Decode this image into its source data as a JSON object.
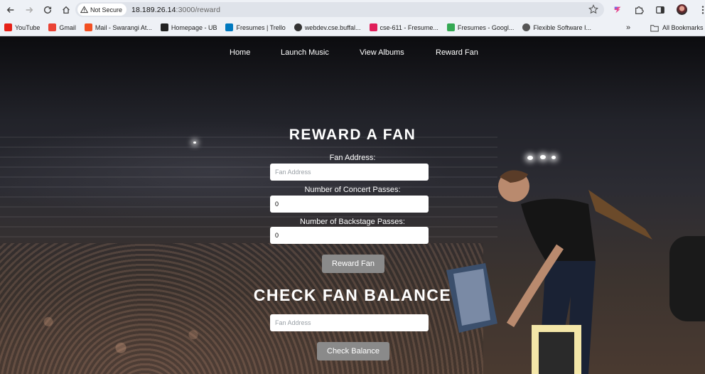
{
  "browser": {
    "security_label": "Not Secure",
    "url_host": "18.189.26.14",
    "url_path": ":3000/reward",
    "bookmarks": [
      {
        "label": "YouTube",
        "color": "#e62117"
      },
      {
        "label": "Gmail",
        "color": "#ea4335"
      },
      {
        "label": "Mail - Swarangi At...",
        "color": "#f25022"
      },
      {
        "label": "Homepage - UB",
        "color": "#222222"
      },
      {
        "label": "Fresumes | Trello",
        "color": "#0079bf"
      },
      {
        "label": "webdev.cse.buffal...",
        "color": "#333333"
      },
      {
        "label": "cse-611 - Fresume...",
        "color": "#e01e5a"
      },
      {
        "label": "Fresumes - Googl...",
        "color": "#34a853"
      },
      {
        "label": "Flexible Software I...",
        "color": "#555555"
      }
    ],
    "more_label": "»",
    "all_bookmarks_label": "All Bookmarks"
  },
  "nav": {
    "items": [
      "Home",
      "Launch Music",
      "View Albums",
      "Reward Fan"
    ]
  },
  "reward_section": {
    "title": "REWARD A FAN",
    "fan_address_label": "Fan Address:",
    "fan_address_placeholder": "Fan Address",
    "concert_passes_label": "Number of Concert Passes:",
    "concert_passes_value": "0",
    "backstage_passes_label": "Number of Backstage Passes:",
    "backstage_passes_value": "0",
    "submit_label": "Reward Fan"
  },
  "balance_section": {
    "title": "CHECK FAN BALANCE",
    "fan_address_placeholder": "Fan Address",
    "submit_label": "Check Balance"
  }
}
